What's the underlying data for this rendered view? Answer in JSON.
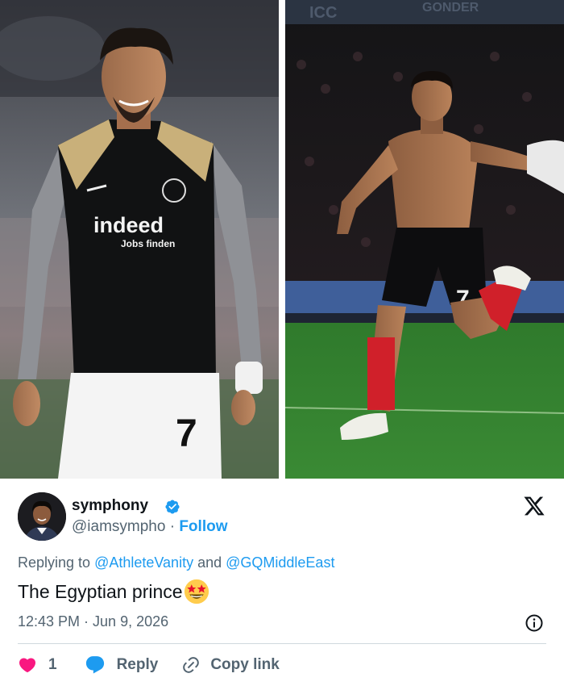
{
  "photos": {
    "left_alt": "Player smiling in black Eintracht training top with indeed sponsor",
    "right_alt": "Shirtless player celebrating a goal in front of a crowd",
    "left_shirt_sponsor": "indeed",
    "left_shirt_tagline": "Jobs finden",
    "shorts_number": "7",
    "board_text_left": "ICC",
    "board_text_right": "GONDER"
  },
  "tweet": {
    "display_name": "symphony",
    "handle": "@iamsympho",
    "separator": " · ",
    "follow_label": "Follow",
    "replying_prefix": "Replying to ",
    "reply_to_1": "@AthleteVanity",
    "reply_and": " and ",
    "reply_to_2": "@GQMiddleEast",
    "text": "The Egyptian prince",
    "emoji": "star-struck",
    "timestamp": "12:43 PM · Jun 9, 2026",
    "like_count": "1",
    "reply_label": "Reply",
    "copy_link_label": "Copy link"
  },
  "colors": {
    "accent_blue": "#1d9bf0",
    "like_pink": "#f91880",
    "text_primary": "#0f1419",
    "text_secondary": "#536471",
    "divider": "#cfd9de"
  },
  "icons": [
    "verified-badge-icon",
    "x-logo-icon",
    "star-struck-emoji-icon",
    "info-icon",
    "heart-icon",
    "reply-bubble-icon",
    "link-icon"
  ]
}
